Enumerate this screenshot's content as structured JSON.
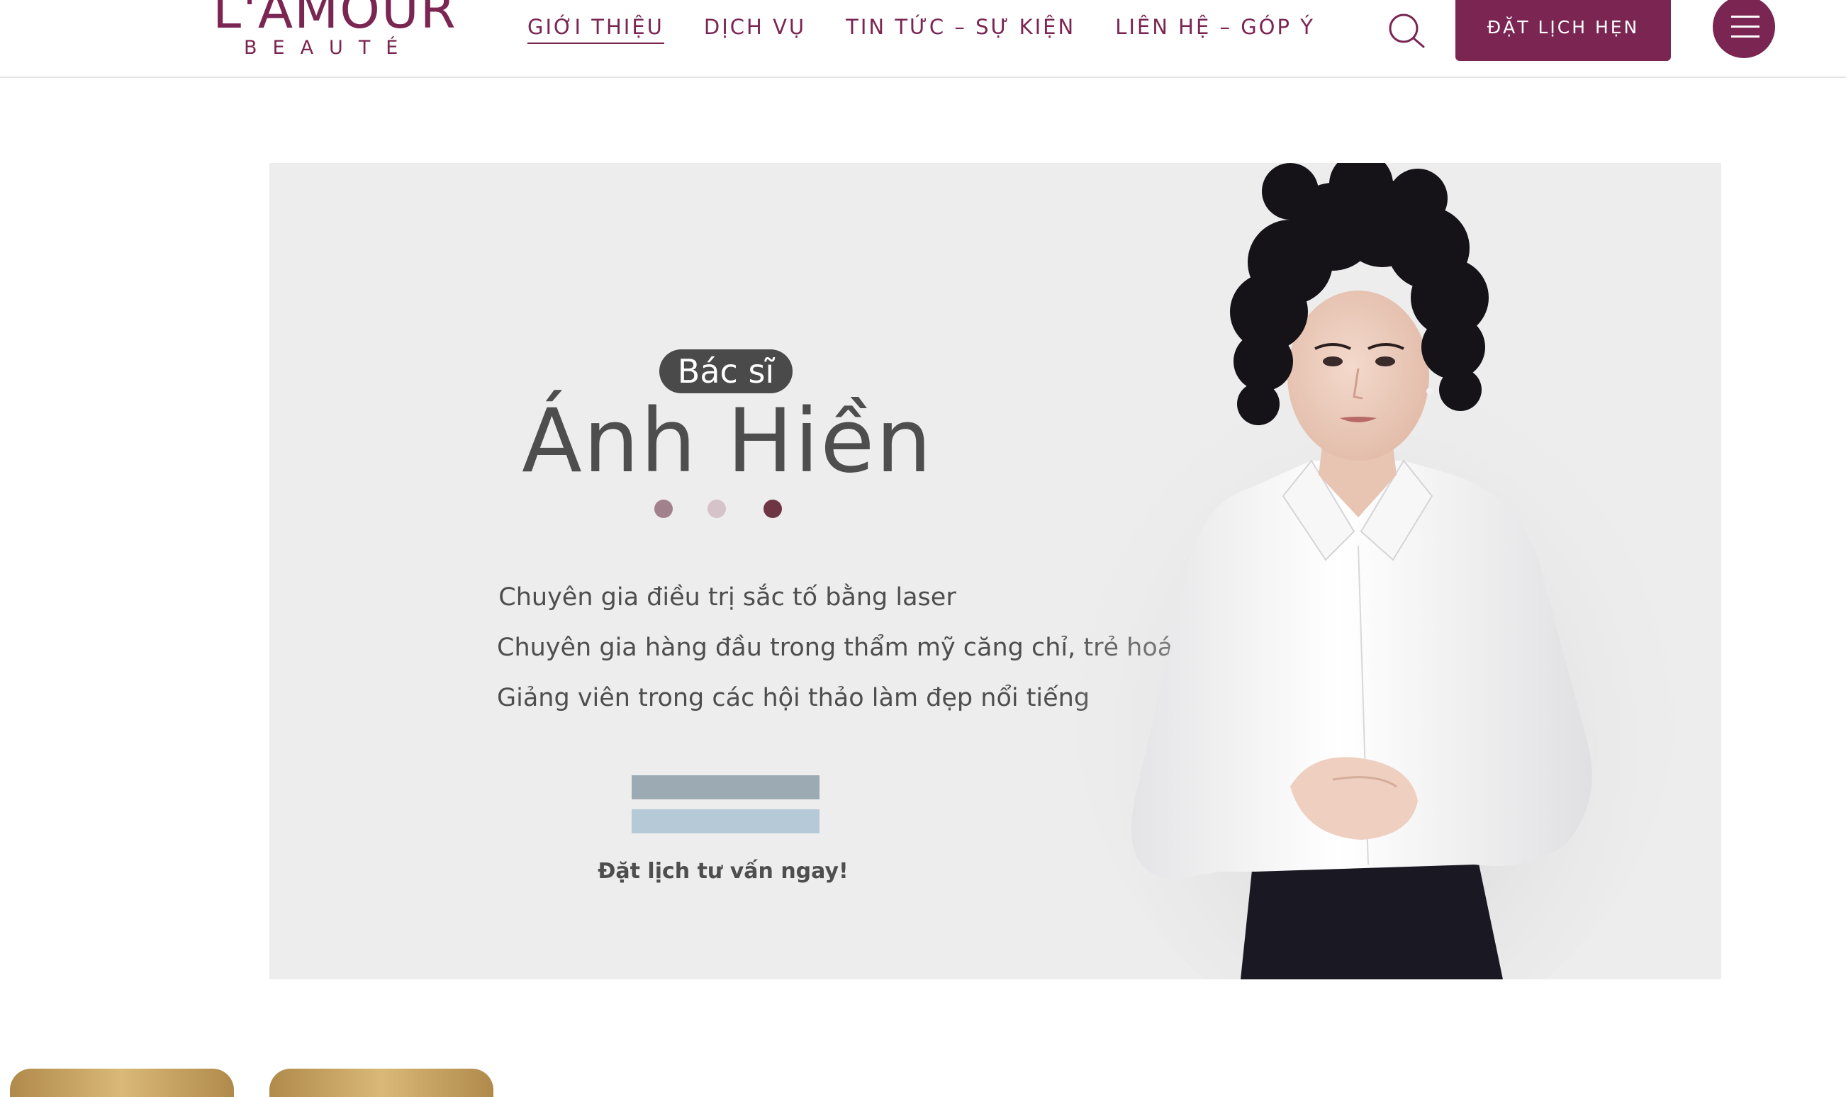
{
  "header": {
    "logo_main": "L'AMOUR",
    "logo_sub": "BEAUTÉ",
    "nav": [
      {
        "label": "GIỚI THIỆU",
        "active": true
      },
      {
        "label": "DỊCH VỤ",
        "active": false
      },
      {
        "label": "TIN TỨC – SỰ KIỆN",
        "active": false
      },
      {
        "label": "LIÊN HỆ – GÓP Ý",
        "active": false
      }
    ],
    "cta_label": "ĐẶT LỊCH HẸN"
  },
  "hero": {
    "badge": "Bác sĩ",
    "name": "Ánh Hiền",
    "descriptions": [
      "Chuyên gia điều trị sắc tố bằng laser",
      "Chuyên gia hàng đầu trong thẩm mỹ căng chỉ, trẻ hoá",
      "Giảng viên trong các hội thảo làm đẹp nổi tiếng"
    ],
    "consult_link": "Đặt lịch tư vấn ngay!"
  },
  "colors": {
    "brand": "#7a2552",
    "dot_1": "#a1818c",
    "dot_2": "#d6c3ca",
    "dot_3": "#6e3645",
    "bar_1": "#9caab3",
    "bar_2": "#b6c9d6"
  },
  "icons": {
    "search": "search-icon",
    "menu": "hamburger-menu-icon"
  }
}
